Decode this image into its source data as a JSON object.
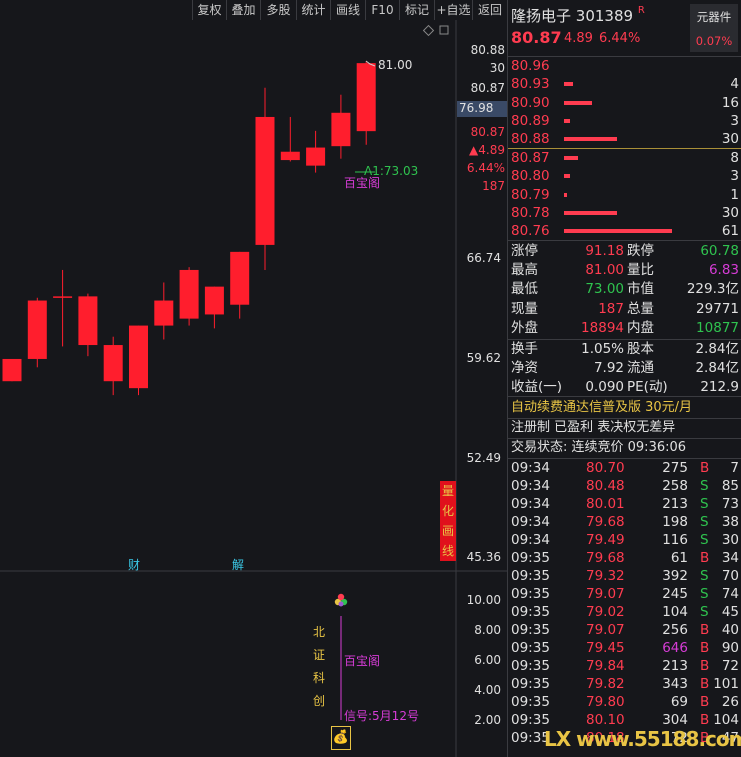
{
  "toolbar": {
    "buttons": [
      "复权",
      "叠加",
      "多股",
      "统计",
      "画线",
      "F10",
      "标记",
      "+自选",
      "返回"
    ]
  },
  "chart": {
    "price_axis": [
      "80.88",
      "30",
      "80.87",
      "76.98",
      "80.87",
      "▲4.89",
      "6.44%",
      "187",
      "66.74",
      "59.62",
      "52.49",
      "45.36"
    ],
    "high_label": "81.00",
    "avg_label": "A1:73.03",
    "baibaoge_top": "百宝阁",
    "markers": [
      "财",
      "解"
    ],
    "quant_text": [
      "量",
      "化",
      "画",
      "线"
    ],
    "indicator_axis": [
      "10.00",
      "8.00",
      "6.00",
      "4.00",
      "2.00"
    ],
    "side_text": [
      "北",
      "证",
      "科",
      "创"
    ],
    "baibaoge_bottom": "百宝阁",
    "signal_text": "信号:5月12号",
    "watermark": "LX www.55188.com"
  },
  "chart_data": {
    "type": "candlestick",
    "series": [
      {
        "o": 58.0,
        "c": 59.6,
        "h": 59.6,
        "l": 58.0
      },
      {
        "o": 59.6,
        "c": 63.8,
        "h": 64.0,
        "l": 59.0
      },
      {
        "o": 64.1,
        "c": 64.1,
        "h": 66.0,
        "l": 60.5
      },
      {
        "o": 64.1,
        "c": 60.6,
        "h": 64.3,
        "l": 59.8
      },
      {
        "o": 58.0,
        "c": 60.6,
        "h": 61.2,
        "l": 57.0
      },
      {
        "o": 57.5,
        "c": 62.0,
        "h": 62.0,
        "l": 57.0
      },
      {
        "o": 62.0,
        "c": 63.8,
        "h": 65.1,
        "l": 61.0
      },
      {
        "o": 62.5,
        "c": 66.0,
        "h": 66.2,
        "l": 62.0
      },
      {
        "o": 62.8,
        "c": 64.8,
        "h": 64.8,
        "l": 61.8
      },
      {
        "o": 63.5,
        "c": 67.3,
        "h": 67.3,
        "l": 62.5
      },
      {
        "o": 67.8,
        "c": 77.0,
        "h": 79.1,
        "l": 66.0
      },
      {
        "o": 74.5,
        "c": 73.9,
        "h": 77.0,
        "l": 73.8
      },
      {
        "o": 73.5,
        "c": 74.8,
        "h": 76.0,
        "l": 73.0
      },
      {
        "o": 74.9,
        "c": 77.3,
        "h": 78.6,
        "l": 74.0
      },
      {
        "o": 75.98,
        "c": 80.87,
        "h": 81.0,
        "l": 75.0
      }
    ],
    "ylim": [
      45.36,
      80.88
    ]
  },
  "panel": {
    "stock_name": "隆扬电子",
    "stock_code": "301389",
    "r_mark": "R",
    "price": "80.87",
    "change": "4.89",
    "change_pct": "6.44%",
    "tag_label": "元器件",
    "tag_pct": "0.07%",
    "asks": [
      {
        "price": "80.96",
        "vol": "",
        "bar": 0
      },
      {
        "price": "80.93",
        "vol": "4",
        "bar": 0.08
      },
      {
        "price": "80.90",
        "vol": "16",
        "bar": 0.26
      },
      {
        "price": "80.89",
        "vol": "3",
        "bar": 0.06
      },
      {
        "price": "80.88",
        "vol": "30",
        "bar": 0.49
      }
    ],
    "bids": [
      {
        "price": "80.87",
        "vol": "8",
        "bar": 0.13
      },
      {
        "price": "80.80",
        "vol": "3",
        "bar": 0.06
      },
      {
        "price": "80.79",
        "vol": "1",
        "bar": 0.02
      },
      {
        "price": "80.78",
        "vol": "30",
        "bar": 0.49
      },
      {
        "price": "80.76",
        "vol": "61",
        "bar": 1.0
      }
    ],
    "stats": [
      {
        "l1": "涨停",
        "v1": "91.18",
        "c1": "red",
        "l2": "跌停",
        "v2": "60.78",
        "c2": "green"
      },
      {
        "l1": "最高",
        "v1": "81.00",
        "c1": "red",
        "l2": "量比",
        "v2": "6.83",
        "c2": "purple"
      },
      {
        "l1": "最低",
        "v1": "73.00",
        "c1": "green",
        "l2": "市值",
        "v2": "229.3亿",
        "c2": "white"
      },
      {
        "l1": "现量",
        "v1": "187",
        "c1": "red",
        "l2": "总量",
        "v2": "29771",
        "c2": "white"
      },
      {
        "l1": "外盘",
        "v1": "18894",
        "c1": "red",
        "l2": "内盘",
        "v2": "10877",
        "c2": "green"
      }
    ],
    "stats2": [
      {
        "l1": "换手",
        "v1": "1.05%",
        "l2": "股本",
        "v2": "2.84亿"
      },
      {
        "l1": "净资",
        "v1": "7.92",
        "l2": "流通",
        "v2": "2.84亿"
      },
      {
        "l1": "收益(一)",
        "v1": "0.090",
        "l2": "PE(动)",
        "v2": "212.9"
      }
    ],
    "promo": "自动续费通达信普及版  30元/月",
    "reg_info": "注册制 已盈利 表决权无差异",
    "trade_status": "交易状态: 连续竞价 09:36:06",
    "trades": [
      {
        "t": "09:34",
        "p": "80.70",
        "v": "275",
        "d": "B",
        "n": "7"
      },
      {
        "t": "09:34",
        "p": "80.48",
        "v": "258",
        "d": "S",
        "n": "85"
      },
      {
        "t": "09:34",
        "p": "80.01",
        "v": "213",
        "d": "S",
        "n": "73"
      },
      {
        "t": "09:34",
        "p": "79.68",
        "v": "198",
        "d": "S",
        "n": "38"
      },
      {
        "t": "09:34",
        "p": "79.49",
        "v": "116",
        "d": "S",
        "n": "30"
      },
      {
        "t": "09:35",
        "p": "79.68",
        "v": "61",
        "d": "B",
        "n": "34"
      },
      {
        "t": "09:35",
        "p": "79.32",
        "v": "392",
        "d": "S",
        "n": "70"
      },
      {
        "t": "09:35",
        "p": "79.07",
        "v": "245",
        "d": "S",
        "n": "74"
      },
      {
        "t": "09:35",
        "p": "79.02",
        "v": "104",
        "d": "S",
        "n": "45"
      },
      {
        "t": "09:35",
        "p": "79.07",
        "v": "256",
        "d": "B",
        "n": "40"
      },
      {
        "t": "09:35",
        "p": "79.45",
        "v": "646",
        "d": "B",
        "n": "90"
      },
      {
        "t": "09:35",
        "p": "79.84",
        "v": "213",
        "d": "B",
        "n": "72"
      },
      {
        "t": "09:35",
        "p": "79.82",
        "v": "343",
        "d": "B",
        "n": "101"
      },
      {
        "t": "09:35",
        "p": "79.80",
        "v": "69",
        "d": "B",
        "n": "26"
      },
      {
        "t": "09:35",
        "p": "80.10",
        "v": "304",
        "d": "B",
        "n": "104"
      },
      {
        "t": "09:35",
        "p": "80.18",
        "v": "72",
        "d": "B",
        "n": "47"
      }
    ]
  },
  "colors": {
    "up": "#ff1e2d",
    "down": "#2fc34f",
    "bg": "#16171b",
    "purple": "#d63cd6",
    "yellow": "#e8c445"
  }
}
